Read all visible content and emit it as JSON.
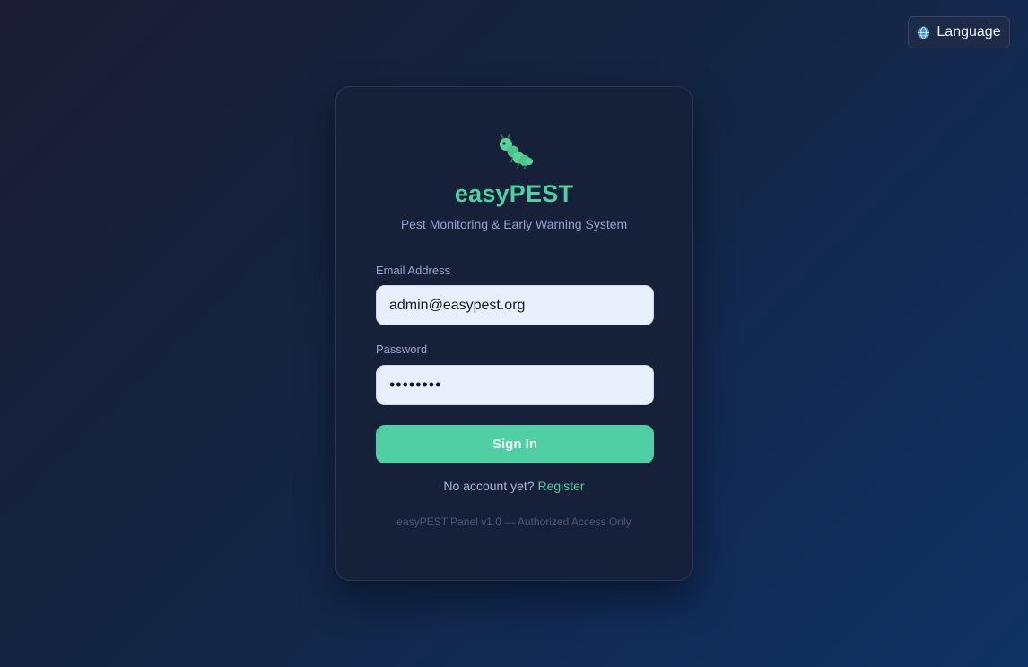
{
  "header": {
    "language_label": "Language",
    "language_icon": "globe-icon"
  },
  "login": {
    "logo_icon": "caterpillar-icon",
    "brand": "easyPEST",
    "tagline": "Pest Monitoring & Early Warning System",
    "email_label": "Email Address",
    "email_value": "admin@easypest.org",
    "password_label": "Password",
    "password_value": "••••••••",
    "signin_label": "Sign In",
    "register_prompt": "No account yet?",
    "register_link": "Register",
    "footer": "easyPEST Panel v1.0 — Authorized Access Only"
  },
  "colors": {
    "accent": "#4fcfa3",
    "card_bg": "#172039",
    "input_bg": "#e9f0fd"
  }
}
